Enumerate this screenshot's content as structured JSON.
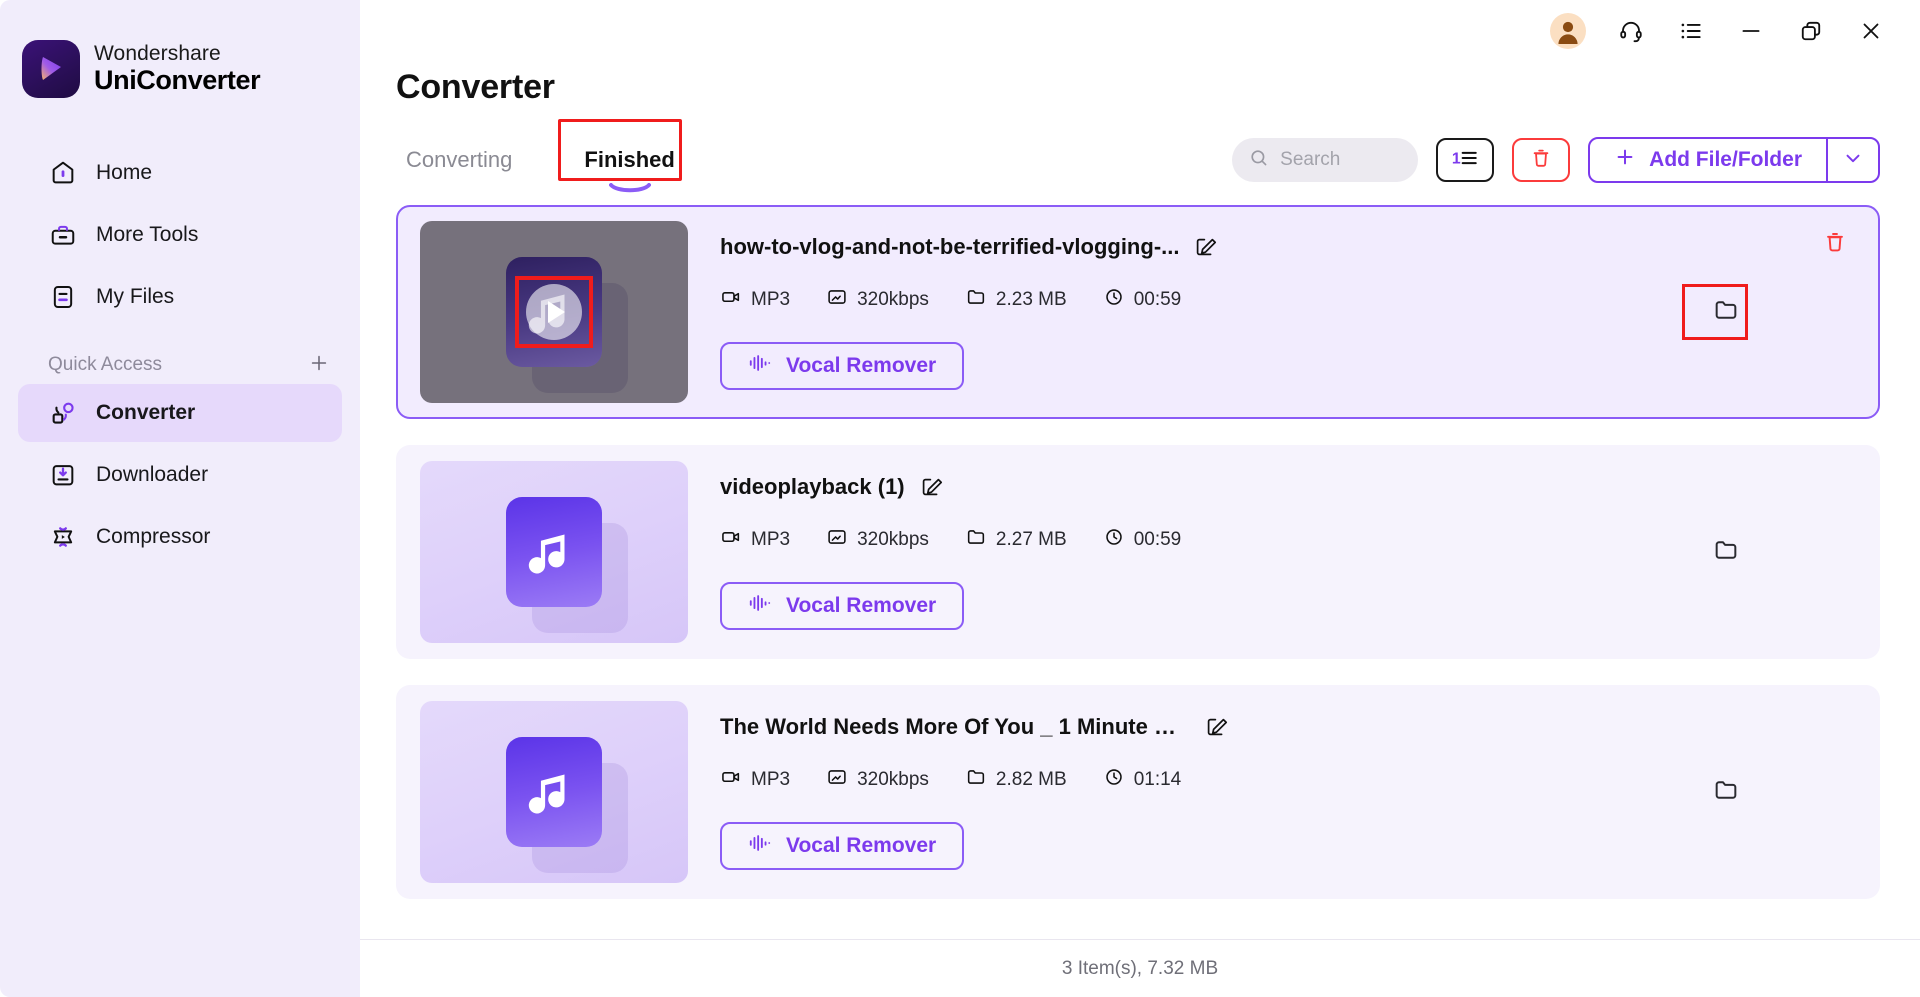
{
  "brand": {
    "line1": "Wondershare",
    "line2": "UniConverter",
    "logo_icon": "uniconverter-play-logo"
  },
  "sidebar": {
    "items": [
      {
        "label": "Home",
        "icon": "home-icon",
        "active": false
      },
      {
        "label": "More Tools",
        "icon": "toolbox-icon",
        "active": false
      },
      {
        "label": "My Files",
        "icon": "file-lines-icon",
        "active": false
      }
    ],
    "quick_access": {
      "label": "Quick Access",
      "add_icon": "plus-icon"
    },
    "quick_items": [
      {
        "label": "Converter",
        "icon": "converter-icon",
        "active": true
      },
      {
        "label": "Downloader",
        "icon": "download-icon",
        "active": false
      },
      {
        "label": "Compressor",
        "icon": "compressor-icon",
        "active": false
      }
    ]
  },
  "window_controls": {
    "account_icon": "account-avatar-icon",
    "support_icon": "headset-icon",
    "menu_icon": "list-menu-icon",
    "minimize_icon": "minimize-icon",
    "restore_icon": "restore-window-icon",
    "close_icon": "close-icon"
  },
  "header": {
    "title": "Converter",
    "tabs": [
      {
        "label": "Converting",
        "active": false
      },
      {
        "label": "Finished",
        "active": true
      }
    ]
  },
  "toolbar": {
    "search_placeholder": "Search",
    "search_value": "",
    "search_icon": "search-icon",
    "sort_icon": "sort-list-icon",
    "delete_icon": "trash-icon",
    "add_label": "Add File/Folder",
    "add_plus_icon": "plus-icon",
    "add_chevron_icon": "chevron-down-icon"
  },
  "files": [
    {
      "name": "how-to-vlog-and-not-be-terrified-vlogging-...",
      "format": "MP3",
      "bitrate": "320kbps",
      "size": "2.23 MB",
      "duration": "00:59",
      "action_label": "Vocal Remover",
      "selected": true,
      "hovered": true,
      "edit_icon": "edit-pencil-icon",
      "format_icon": "video-camera-icon",
      "bitrate_icon": "resolution-icon",
      "size_icon": "folder-icon",
      "duration_icon": "clock-icon",
      "action_icon": "waveform-icon",
      "folder_icon": "open-folder-icon",
      "trash_icon": "trash-icon",
      "play_icon": "play-icon"
    },
    {
      "name": "videoplayback (1)",
      "format": "MP3",
      "bitrate": "320kbps",
      "size": "2.27 MB",
      "duration": "00:59",
      "action_label": "Vocal Remover",
      "selected": false,
      "hovered": false,
      "edit_icon": "edit-pencil-icon",
      "format_icon": "video-camera-icon",
      "bitrate_icon": "resolution-icon",
      "size_icon": "folder-icon",
      "duration_icon": "clock-icon",
      "action_icon": "waveform-icon",
      "folder_icon": "open-folder-icon"
    },
    {
      "name": "The World Needs More Of You _ 1 Minute M...",
      "format": "MP3",
      "bitrate": "320kbps",
      "size": "2.82 MB",
      "duration": "01:14",
      "action_label": "Vocal Remover",
      "selected": false,
      "hovered": false,
      "edit_icon": "edit-pencil-icon",
      "format_icon": "video-camera-icon",
      "bitrate_icon": "resolution-icon",
      "size_icon": "folder-icon",
      "duration_icon": "clock-icon",
      "action_icon": "waveform-icon",
      "folder_icon": "open-folder-icon"
    }
  ],
  "status": {
    "summary": "3 Item(s), 7.32 MB"
  },
  "colors": {
    "accent": "#7c3aed",
    "accent_light": "#8b5cf6",
    "sidebar_bg": "#f1edfb",
    "card_bg": "#f6f3fd",
    "annotation_red": "#f01c1c",
    "danger": "#fb3b3b"
  }
}
